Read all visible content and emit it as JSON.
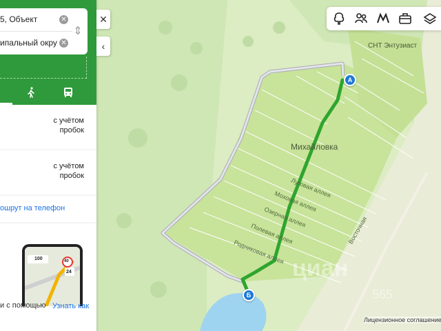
{
  "route_panel": {
    "from_value": "5, Объект",
    "to_value": "ипальный окру",
    "modes": [
      {
        "name": "walking-icon"
      },
      {
        "name": "bus-icon"
      }
    ],
    "options": [
      {
        "traffic_note": "с учётом\nпробок"
      },
      {
        "traffic_note": "с учётом\nпробок"
      }
    ],
    "send_to_phone_label": "ошрут на телефон",
    "promo": {
      "text": "и с помощью",
      "link": "Узнать как",
      "phone_badge_number": "100",
      "phone_speed": "40",
      "phone_value": "24"
    },
    "close_icon": "close-icon",
    "collapse_icon": "chevron-left-icon",
    "accent_color": "#2f9a3b",
    "link_color": "#1a73e8"
  },
  "map": {
    "place_label": "Михайловка",
    "community_label": "СНТ Энтузиаст",
    "streets": [
      "Луговая аллея",
      "Моховая аллея",
      "Озерная аллея",
      "Полевая аллея",
      "Родниковая аллея",
      "Восточная"
    ],
    "marker_start": "А",
    "marker_end": "Б",
    "license_text": "Лицензионное соглашение",
    "watermark": "циан",
    "watermark_small": "565",
    "route_color": "#2ea52e",
    "alt_route_color": "#c9c9d2"
  },
  "toolbar": {
    "icons": [
      "tree-icon",
      "people-icon",
      "metro-icon",
      "briefcase-icon",
      "layers-icon"
    ]
  }
}
